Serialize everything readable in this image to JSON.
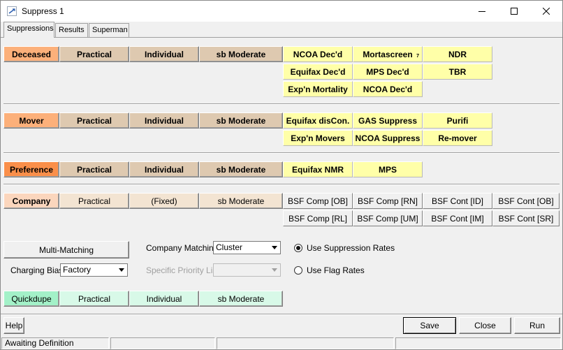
{
  "window": {
    "title": "Suppress 1"
  },
  "tabs": [
    "Suppressions",
    "Results",
    "Superman"
  ],
  "colors": {
    "deceased": "#fcb07a",
    "mover": "#fcb07a",
    "preference": "#fa8f4a",
    "company": "#fbd6bd",
    "quickdupe": "#a3f1c8",
    "tan": "#dec9b0",
    "tan_light": "#f3e4d2",
    "mint": "#d8f9e8",
    "yellow": "#ffffa8"
  },
  "deceased": {
    "label": "Deceased",
    "options": [
      "Practical",
      "Individual",
      "sb Moderate"
    ],
    "sources": [
      "NCOA Dec'd",
      "Mortascreen",
      "NDR",
      "Equifax Dec'd",
      "MPS Dec'd",
      "TBR",
      "Exp'n Mortality",
      "NCOA Dec'd"
    ],
    "mortascreen_marker": "7"
  },
  "mover": {
    "label": "Mover",
    "options": [
      "Practical",
      "Individual",
      "sb Moderate"
    ],
    "sources": [
      "Equifax disCon.",
      "GAS Suppress",
      "Purifi",
      "Exp'n Movers",
      "NCOA Suppress",
      "Re-mover"
    ]
  },
  "preference": {
    "label": "Preference",
    "options": [
      "Practical",
      "Individual",
      "sb Moderate"
    ],
    "sources": [
      "Equifax NMR",
      "MPS"
    ]
  },
  "company": {
    "label": "Company",
    "options": [
      "Practical",
      "(Fixed)",
      "sb Moderate"
    ],
    "sources": [
      "BSF Comp [OB]",
      "BSF Comp [RN]",
      "BSF Cont [ID]",
      "BSF Cont [OB]",
      "BSF Comp [RL]",
      "BSF Comp [UM]",
      "BSF Cont [IM]",
      "BSF Cont [SR]"
    ]
  },
  "settings": {
    "multi_matching_label": "Multi-Matching",
    "charging_bias_label": "Charging Bias:",
    "charging_bias_value": "Factory",
    "company_matching_label": "Company Matching:",
    "company_matching_value": "Cluster",
    "priority_list_label": "Specific Priority List:",
    "priority_list_value": "",
    "radio_suppression": "Use Suppression Rates",
    "radio_flag": "Use Flag Rates",
    "selected_radio": "suppression"
  },
  "quickdupe": {
    "label": "Quickdupe",
    "options": [
      "Practical",
      "Individual",
      "sb Moderate"
    ]
  },
  "footer": {
    "help": "Help",
    "save": "Save",
    "close": "Close",
    "run": "Run"
  },
  "statusbar": {
    "text": "Awaiting Definition"
  }
}
